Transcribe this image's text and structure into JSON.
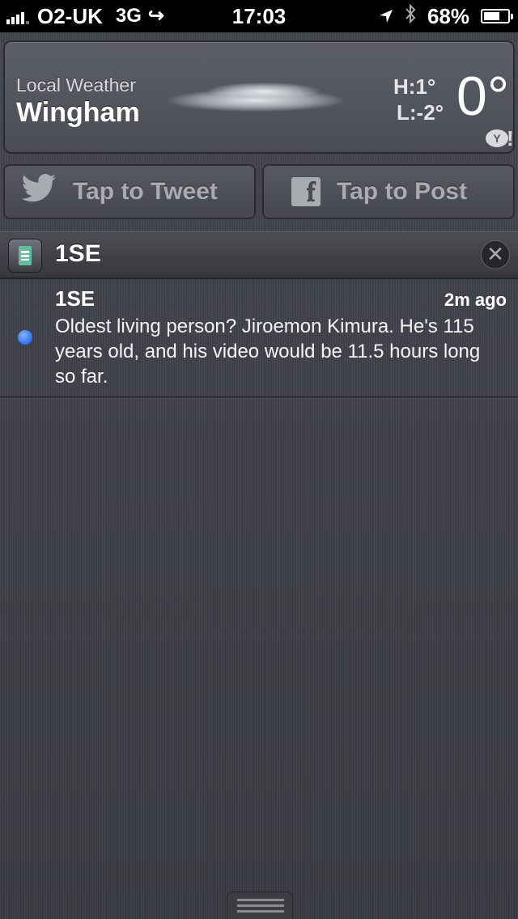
{
  "status_bar": {
    "carrier": "O2-UK",
    "network": "3G",
    "time": "17:03",
    "battery_percent": "68%",
    "battery_level": 0.68,
    "icons": [
      "signal-bars-icon",
      "call-forward-icon",
      "location-arrow-icon",
      "bluetooth-icon",
      "battery-icon"
    ]
  },
  "weather": {
    "label": "Local Weather",
    "city": "Wingham",
    "high": "H:1°",
    "low": "L:-2°",
    "temperature": "0°",
    "condition_icon": "cloud-icon",
    "provider_icon": "yahoo-icon"
  },
  "share": {
    "tweet_label": "Tap to Tweet",
    "post_label": "Tap to Post"
  },
  "notification_group": {
    "app_name": "1SE",
    "items": [
      {
        "title": "1SE",
        "time": "2m ago",
        "body": "Oldest living person? Jiroemon Kimura. He's 115 years old, and his video would be 11.5 hours long so far.",
        "unread": true
      }
    ]
  },
  "colors": {
    "background": "#3e4047",
    "unread_dot": "#2f6ff0",
    "status_bar": "#000000"
  }
}
